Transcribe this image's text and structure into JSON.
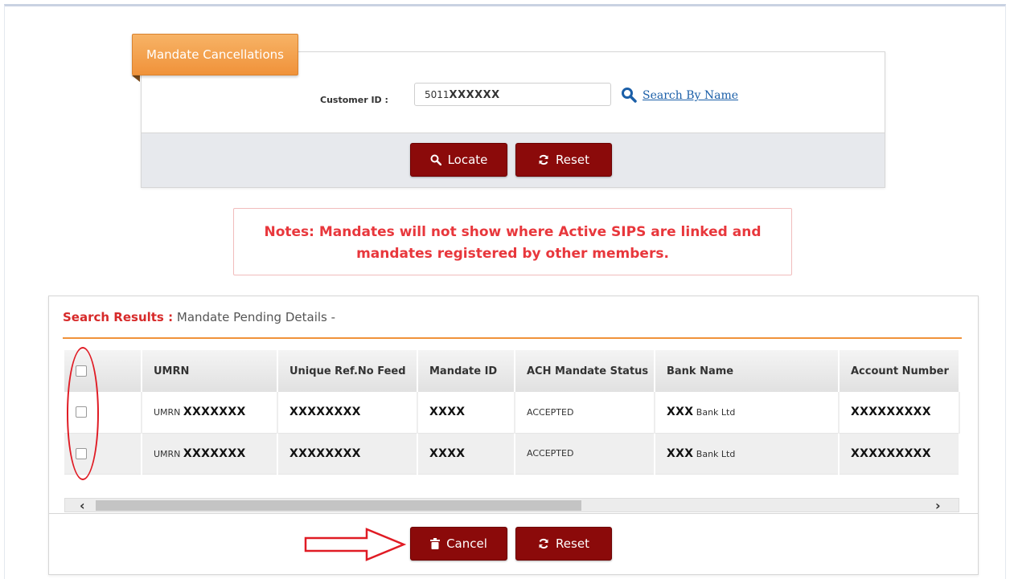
{
  "tab": {
    "label": "Mandate Cancellations"
  },
  "form": {
    "customer_label": "Customer ID :",
    "customer_value_prefix": "5011",
    "customer_value_masked": "XXXXXX",
    "search_link": "Search By Name"
  },
  "top_actions": {
    "locate": "Locate",
    "reset": "Reset"
  },
  "notes": {
    "line1": "Notes: Mandates will not show where Active SIPS are linked and",
    "line2": "mandates registered by other members."
  },
  "results": {
    "title_prefix": "Search Results :",
    "title_rest": "Mandate Pending Details -",
    "columns": [
      "UMRN",
      "Unique Ref.No Feed",
      "Mandate ID",
      "ACH Mandate Status",
      "Bank Name",
      "Account Number"
    ],
    "rows": [
      {
        "umrn_prefix": "UMRN",
        "umrn": "XXXXXXX",
        "ref": "XXXXXXXX",
        "mandate_id": "XXXX",
        "status": "ACCEPTED",
        "bank_prefix": "XXX",
        "bank_suffix": "Bank Ltd",
        "account": "XXXXXXXXX"
      },
      {
        "umrn_prefix": "UMRN",
        "umrn": "XXXXXXX",
        "ref": "XXXXXXXX",
        "mandate_id": "XXXX",
        "status": "ACCEPTED",
        "bank_prefix": "XXX",
        "bank_suffix": "Bank Ltd",
        "account": "XXXXXXXXX"
      }
    ]
  },
  "bottom_actions": {
    "cancel": "Cancel",
    "reset": "Reset"
  },
  "colors": {
    "accent_orange": "#f0923a",
    "button_maroon": "#8b0a0a",
    "notes_red": "#e8373c",
    "link_blue": "#1b5fa8",
    "annotation_red": "#e01b24"
  }
}
